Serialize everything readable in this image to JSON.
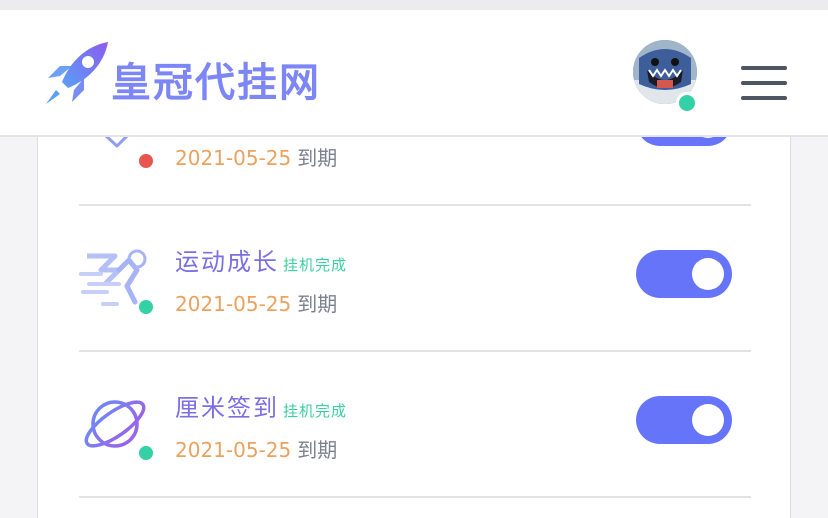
{
  "header": {
    "brand": "皇冠代挂网",
    "logo_icon": "rocket-icon",
    "avatar_status_color": "#35d1a6",
    "menu_icon": "hamburger-menu-icon"
  },
  "items": [
    {
      "name": "",
      "tag": "",
      "date": "2021-05-25",
      "suffix": "到期",
      "icon": "chevron-down-icon",
      "status_color": "#e8554e",
      "enabled": true
    },
    {
      "name": "运动成长",
      "tag": "挂机完成",
      "date": "2021-05-25",
      "suffix": "到期",
      "icon": "runner-icon",
      "status_color": "#35d1a6",
      "enabled": true
    },
    {
      "name": "厘米签到",
      "tag": "挂机完成",
      "date": "2021-05-25",
      "suffix": "到期",
      "icon": "planet-icon",
      "status_color": "#35d1a6",
      "enabled": true
    }
  ],
  "colors": {
    "accent": "#6674fa",
    "name_purple": "#7b6fe6",
    "tag_green": "#3ccf9e",
    "date_orange": "#eba25e"
  }
}
